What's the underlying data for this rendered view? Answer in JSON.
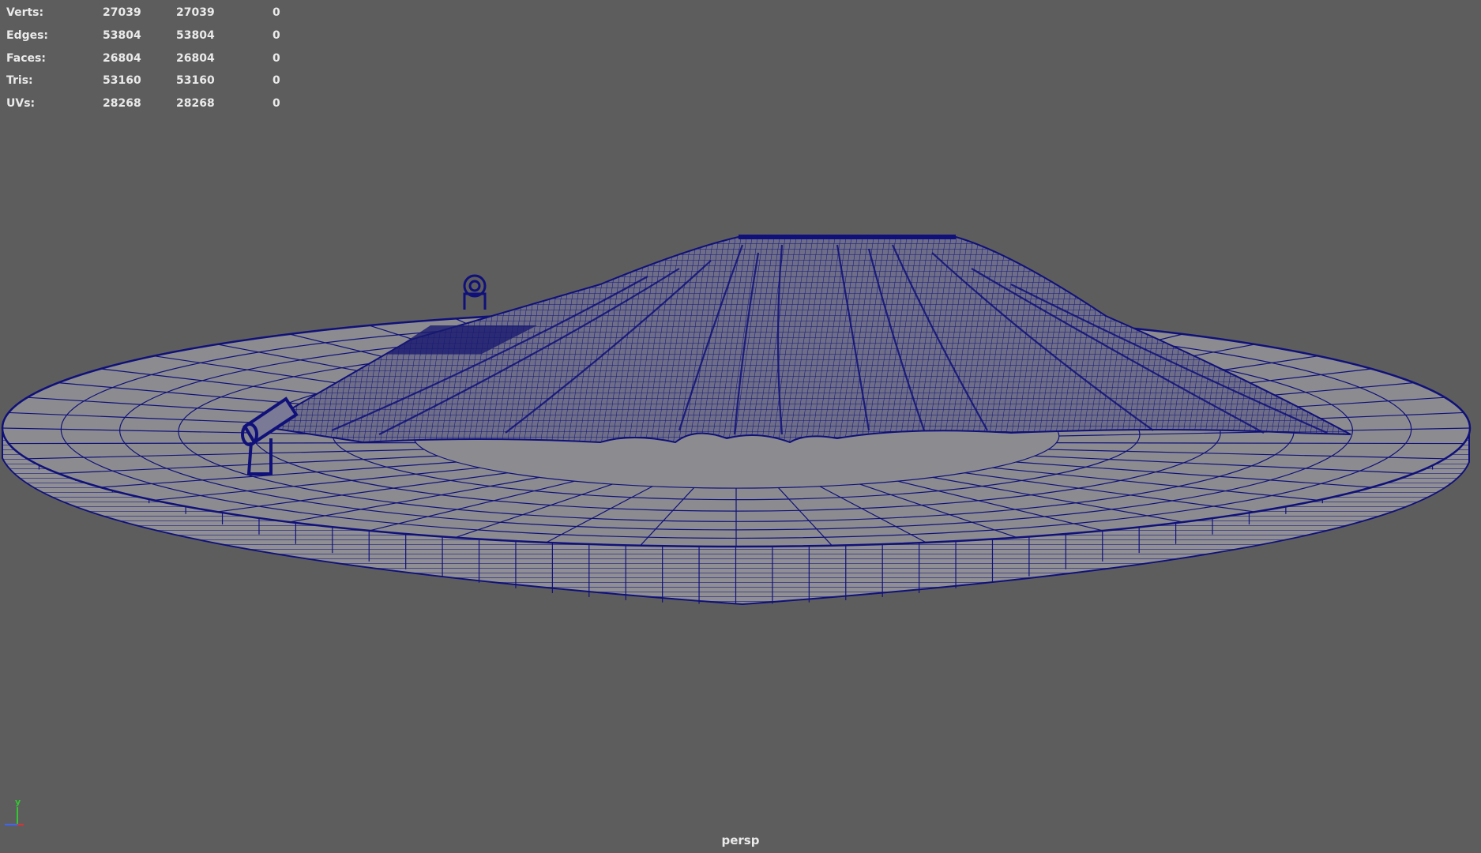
{
  "hud": {
    "rows": [
      {
        "label": "Verts:",
        "a": "27039",
        "b": "27039",
        "c": "0"
      },
      {
        "label": "Edges:",
        "a": "53804",
        "b": "53804",
        "c": "0"
      },
      {
        "label": "Faces:",
        "a": "26804",
        "b": "26804",
        "c": "0"
      },
      {
        "label": "Tris:",
        "a": "53160",
        "b": "53160",
        "c": "0"
      },
      {
        "label": "UVs:",
        "a": "28268",
        "b": "28268",
        "c": "0"
      }
    ]
  },
  "camera_label": "persp",
  "axis": {
    "y_label": "y"
  },
  "colors": {
    "background": "#5d5d5d",
    "wireframe": "#10107a",
    "hud_text": "#eaeaea"
  },
  "icons": [
    "light-icon",
    "axis-gizmo-icon"
  ]
}
